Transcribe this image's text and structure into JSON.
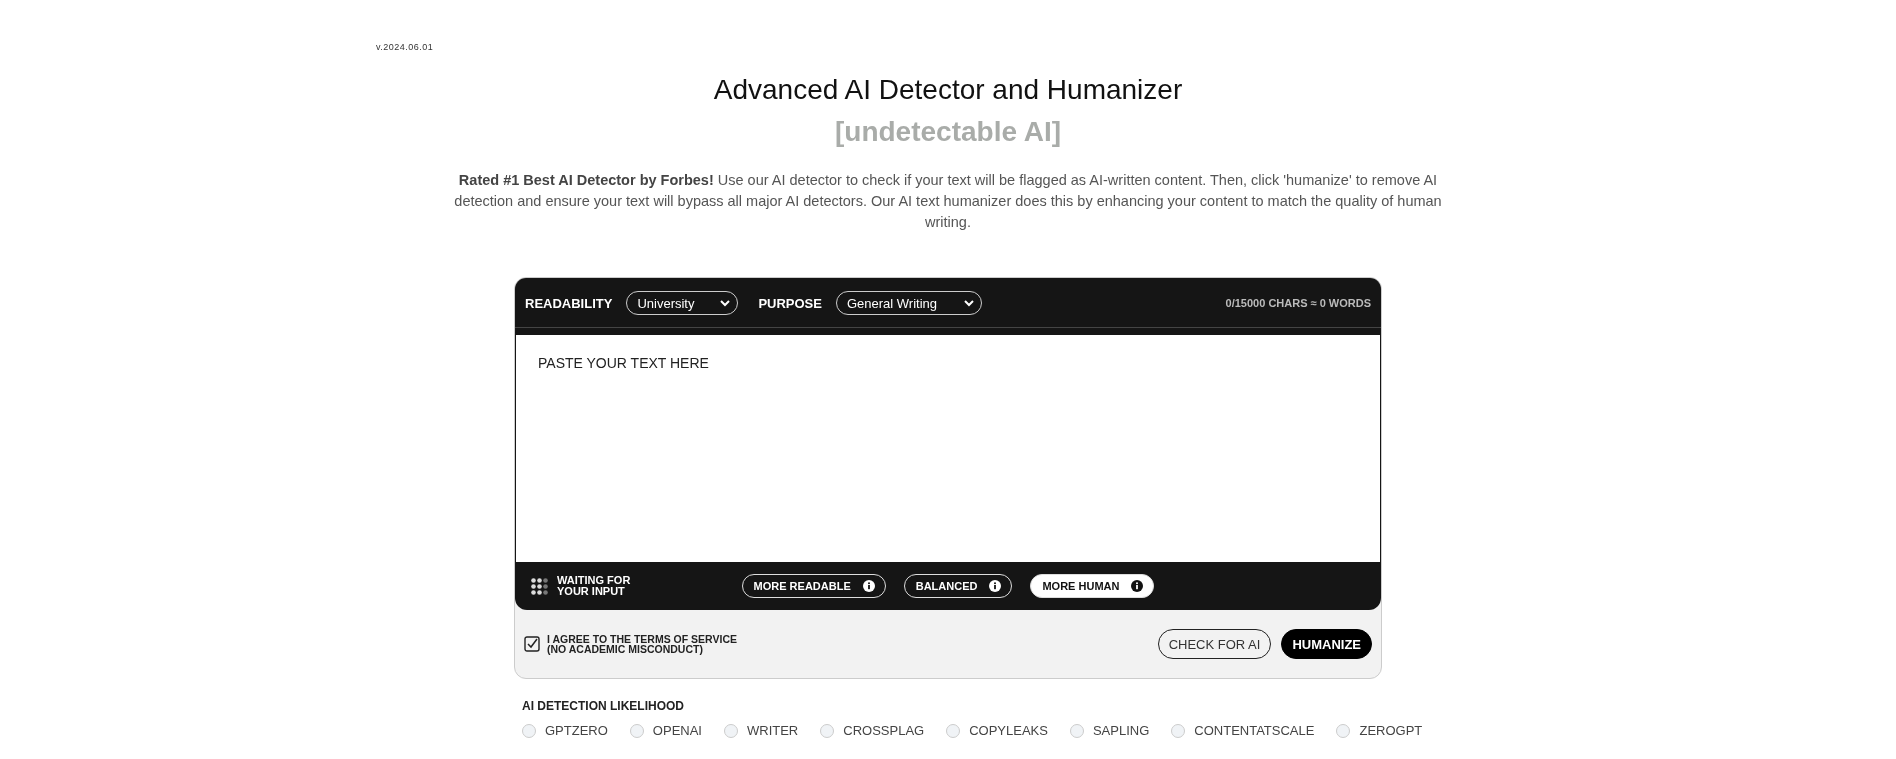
{
  "version": "v.2024.06.01",
  "title": "Advanced AI Detector and Humanizer",
  "subtitle": "[undetectable AI]",
  "intro": "**Rated #1 Best AI Detector by Forbes!** Use our AI detector to check if your text will be flagged as AI-written content. Then, click 'humanize' to remove AI detection and ensure your text will bypass all major AI detectors. Our AI text humanizer does this by enhancing your content to match the quality of human writing.",
  "editor": {
    "settings": [
      {
        "label": "READABILITY",
        "value": "University"
      },
      {
        "label": "PURPOSE",
        "value": "General Writing"
      }
    ],
    "counter": "0/15000 CHARS ≈ 0 WORDS",
    "placeholder": "PASTE YOUR TEXT HERE",
    "status": "WAITING FOR YOUR INPUT",
    "modes": [
      {
        "label": "MORE READABLE",
        "selected": false
      },
      {
        "label": "BALANCED",
        "selected": false
      },
      {
        "label": "MORE HUMAN",
        "selected": true
      }
    ],
    "agreement": {
      "label": "I AGREE TO THE TERMS OF SERVICE",
      "note": "(NO ACADEMIC MISCONDUCT)",
      "checked": true
    },
    "buttons": [
      {
        "label": "CHECK FOR AI",
        "kind": "outline"
      },
      {
        "label": "HUMANIZE",
        "kind": "solid"
      }
    ]
  },
  "detection": {
    "title": "AI DETECTION LIKELIHOOD",
    "detectors": [
      {
        "name": "GPTZERO",
        "selected": false
      },
      {
        "name": "OPENAI",
        "selected": false
      },
      {
        "name": "WRITER",
        "selected": false
      },
      {
        "name": "CROSSPLAG",
        "selected": false
      },
      {
        "name": "COPYLEAKS",
        "selected": false
      },
      {
        "name": "SAPLING",
        "selected": false
      },
      {
        "name": "CONTENTATSCALE",
        "selected": false
      },
      {
        "name": "ZEROGPT",
        "selected": false
      }
    ]
  }
}
